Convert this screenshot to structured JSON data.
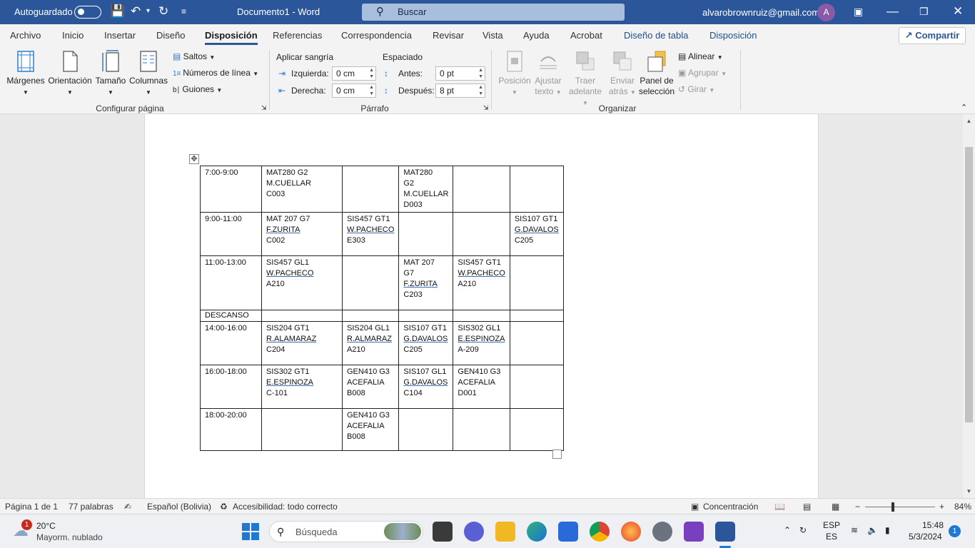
{
  "titlebar": {
    "autosave_label": "Autoguardado",
    "doc_title": "Documento1  -  Word",
    "search_label": "Buscar",
    "account_email": "alvarobrownruiz@gmail.com",
    "avatar_letter": "A"
  },
  "menu": {
    "tabs": [
      "Archivo",
      "Inicio",
      "Insertar",
      "Diseño",
      "Disposición",
      "Referencias",
      "Correspondencia",
      "Revisar",
      "Vista",
      "Ayuda",
      "Acrobat"
    ],
    "context_tabs": [
      "Diseño de tabla",
      "Disposición"
    ],
    "share_label": "Compartir"
  },
  "ribbon": {
    "page_setup": {
      "margins": "Márgenes",
      "orientation": "Orientación",
      "size": "Tamaño",
      "columns": "Columnas",
      "breaks": "Saltos",
      "line_numbers": "Números de línea",
      "hyphenation": "Guiones",
      "group_label": "Configurar página"
    },
    "paragraph": {
      "indent_title": "Aplicar sangría",
      "spacing_title": "Espaciado",
      "left_label": "Izquierda:",
      "left_value": "0 cm",
      "right_label": "Derecha:",
      "right_value": "0 cm",
      "before_label": "Antes:",
      "before_value": "0 pt",
      "after_label": "Después:",
      "after_value": "8 pt",
      "group_label": "Párrafo"
    },
    "arrange": {
      "position": [
        "Posición"
      ],
      "wrap": [
        "Ajustar",
        "texto"
      ],
      "forward": [
        "Traer",
        "adelante"
      ],
      "backward": [
        "Enviar",
        "atrás"
      ],
      "selection_pane": [
        "Panel de",
        "selección"
      ],
      "align": "Alinear",
      "group": "Agrupar",
      "rotate": "Girar",
      "group_label": "Organizar"
    }
  },
  "table": {
    "rows": [
      [
        "7:00-9:00",
        "MAT280 G2\nM.CUELLAR\nC003",
        "",
        "MAT280\nG2\nM.CUELLAR\nD003",
        "",
        ""
      ],
      [
        "9:00-11:00",
        "MAT 207 G7\nF.ZURITA\nC002",
        "SIS457 GT1\nW.PACHECO\nE303",
        "",
        "",
        "SIS107 GT1\nG.DAVALOS\nC205"
      ],
      [
        "11:00-13:00",
        "SIS457 GL1\nW.PACHECO\nA210",
        "",
        "MAT 207\nG7\nF.ZURITA\nC203",
        "SIS457 GT1\nW.PACHECO\nA210",
        ""
      ],
      [
        "DESCANSO",
        "",
        "",
        "",
        "",
        ""
      ],
      [
        "14:00-16:00",
        "SIS204 GT1\nR.ALAMARAZ\nC204",
        "SIS204 GL1\nR.ALMARAZ\nA210",
        "SIS107 GT1\nG.DAVALOS\nC205",
        "SIS302 GL1\nE.ESPINOZA\nA-209",
        ""
      ],
      [
        "16:00-18:00",
        "SIS302 GT1\nE.ESPINOZA\nC-101",
        "GEN410 G3\nACEFALIA\nB008",
        "SIS107 GL1\nG.DAVALOS\nC104",
        "GEN410 G3\nACEFALIA\nD001",
        ""
      ],
      [
        "18:00-20:00",
        "",
        "GEN410 G3\nACEFALIA\nB008",
        "",
        "",
        ""
      ]
    ]
  },
  "statusbar": {
    "page": "Página 1 de 1",
    "words": "77 palabras",
    "language": "Español (Bolivia)",
    "accessibility": "Accesibilidad: todo correcto",
    "focus": "Concentración",
    "zoom": "84%"
  },
  "taskbar": {
    "weather_temp": "20°C",
    "weather_desc": "Mayorm. nublado",
    "weather_badge": "1",
    "search_label": "Búsqueda",
    "lang_top": "ESP",
    "lang_bottom": "ES",
    "time": "15:48",
    "date": "5/3/2024",
    "notif_count": "1"
  }
}
